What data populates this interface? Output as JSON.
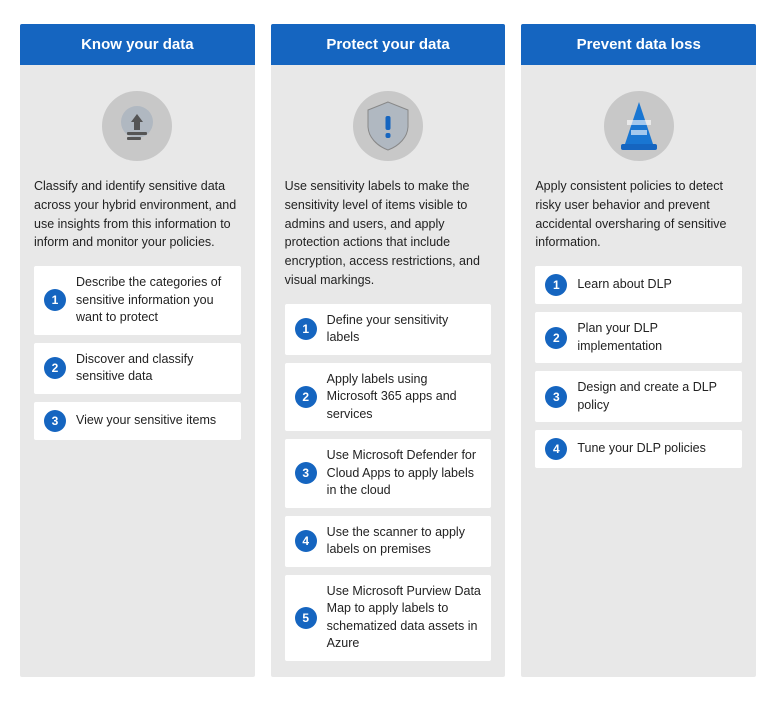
{
  "columns": [
    {
      "id": "know-your-data",
      "header": "Know your data",
      "description": "Classify and identify sensitive data across your hybrid environment, and use insights from this information to inform and monitor your policies.",
      "icon": "data-classify",
      "steps": [
        {
          "number": "1",
          "label": "Describe the categories of sensitive information you want to protect"
        },
        {
          "number": "2",
          "label": "Discover and classify sensitive data"
        },
        {
          "number": "3",
          "label": "View your sensitive items"
        }
      ]
    },
    {
      "id": "protect-your-data",
      "header": "Protect your data",
      "description": "Use sensitivity labels to make the sensitivity level of items visible to admins and users, and apply protection actions that include encryption, access restrictions, and visual markings.",
      "icon": "shield-alert",
      "steps": [
        {
          "number": "1",
          "label": "Define your sensitivity labels"
        },
        {
          "number": "2",
          "label": "Apply labels using Microsoft 365 apps and services"
        },
        {
          "number": "3",
          "label": "Use Microsoft Defender for Cloud Apps to apply labels in the cloud"
        },
        {
          "number": "4",
          "label": "Use the scanner to apply labels on premises"
        },
        {
          "number": "5",
          "label": "Use Microsoft Purview Data Map to apply labels to schematized data assets in Azure"
        }
      ]
    },
    {
      "id": "prevent-data-loss",
      "header": "Prevent data loss",
      "description": "Apply consistent policies to detect risky user behavior and prevent accidental oversharing of sensitive information.",
      "icon": "traffic-cone",
      "steps": [
        {
          "number": "1",
          "label": "Learn about DLP"
        },
        {
          "number": "2",
          "label": "Plan your DLP implementation"
        },
        {
          "number": "3",
          "label": "Design and create a DLP policy"
        },
        {
          "number": "4",
          "label": "Tune your DLP policies"
        }
      ]
    }
  ]
}
